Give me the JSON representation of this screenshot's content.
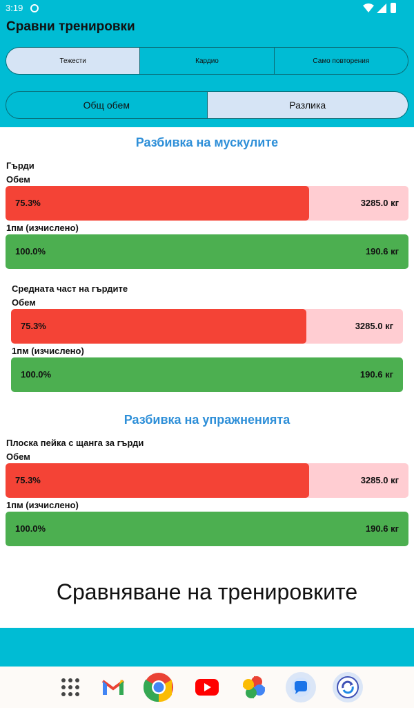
{
  "status_bar": {
    "time": "3:19"
  },
  "app": {
    "title": "Сравни тренировки"
  },
  "category_tabs": [
    {
      "label": "Тежести",
      "active": true
    },
    {
      "label": "Кардио",
      "active": false
    },
    {
      "label": "Само повторения",
      "active": false
    }
  ],
  "mode_tabs": [
    {
      "label": "Общ обем",
      "active": false
    },
    {
      "label": "Разлика",
      "active": true
    }
  ],
  "muscle_section": {
    "title": "Разбивка на мускулите",
    "groups": [
      {
        "name": "Гърди",
        "volume_label": "Обем",
        "volume": {
          "percent_text": "75.3%",
          "percent": 75.3,
          "value": "3285.0 кг"
        },
        "orm_label": "1пм (изчислено)",
        "orm": {
          "percent_text": "100.0%",
          "percent": 100,
          "value": "190.6 кг"
        }
      },
      {
        "name": "Средната част на гърдите",
        "volume_label": "Обем",
        "volume": {
          "percent_text": "75.3%",
          "percent": 75.3,
          "value": "3285.0 кг"
        },
        "orm_label": "1пм (изчислено)",
        "orm": {
          "percent_text": "100.0%",
          "percent": 100,
          "value": "190.6 кг"
        }
      }
    ]
  },
  "exercise_section": {
    "title": "Разбивка на упражненията",
    "groups": [
      {
        "name": "Плоска пейка с щанга за гърди",
        "volume_label": "Обем",
        "volume": {
          "percent_text": "75.3%",
          "percent": 75.3,
          "value": "3285.0 кг"
        },
        "orm_label": "1пм (изчислено)",
        "orm": {
          "percent_text": "100.0%",
          "percent": 100,
          "value": "190.6 кг"
        }
      }
    ]
  },
  "footer_label": "Сравняване на тренировките",
  "nav_icons": [
    "app-drawer-icon",
    "gmail-icon",
    "chrome-icon",
    "youtube-icon",
    "photos-icon",
    "messages-icon",
    "sync-app-icon"
  ],
  "colors": {
    "accent": "#00bcd4",
    "red": "#f44336",
    "red_bg": "#ffcdd2",
    "green": "#4caf50",
    "section_title": "#2e8fd8"
  }
}
